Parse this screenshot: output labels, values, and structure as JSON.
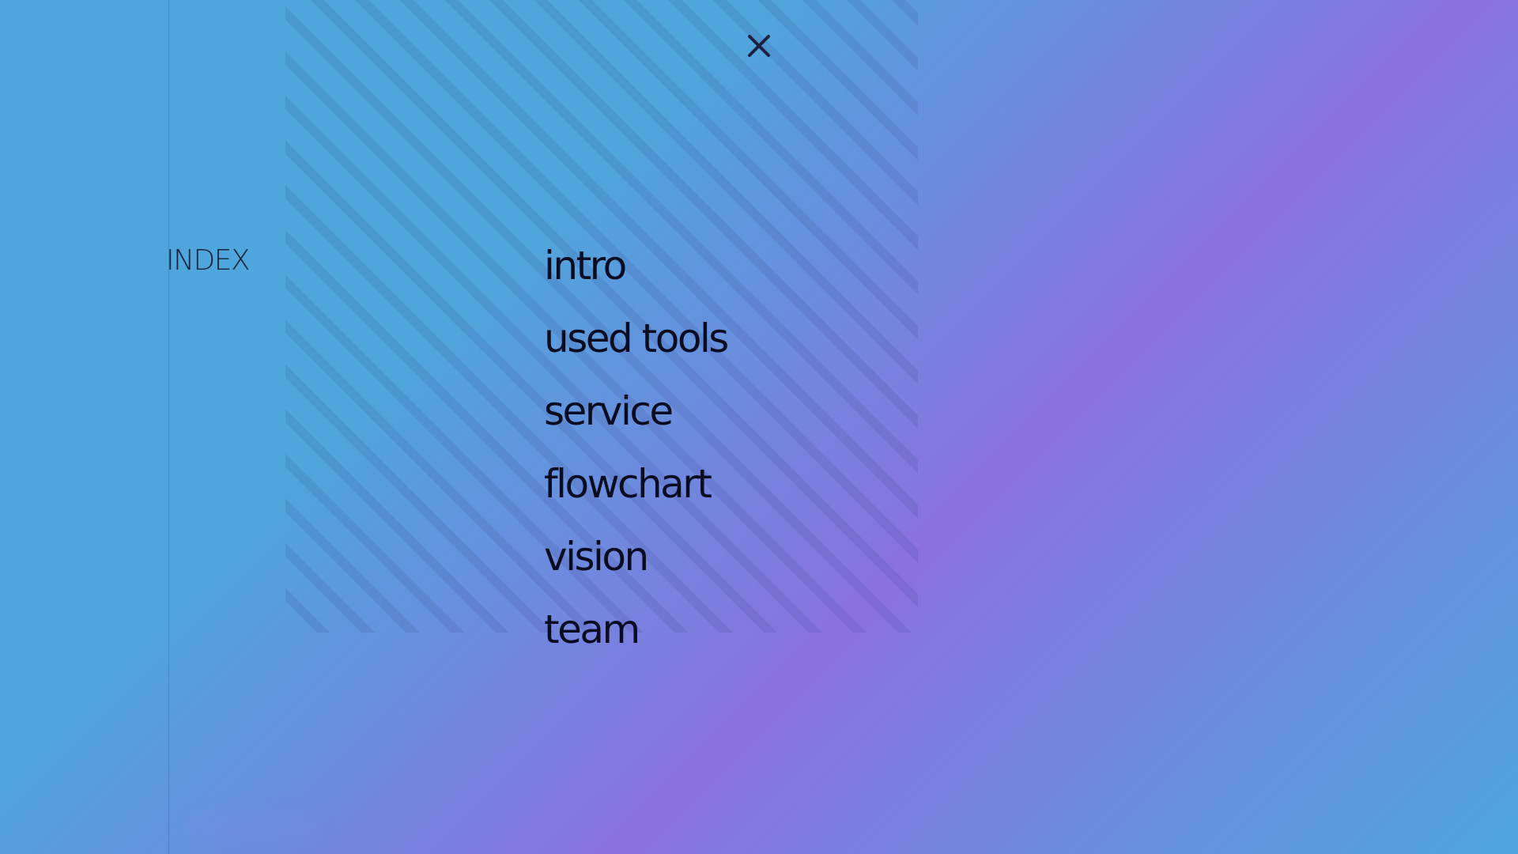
{
  "index_label": "INDEX",
  "close_icon": "close-icon",
  "menu": {
    "items": [
      {
        "label": "intro"
      },
      {
        "label": "used tools"
      },
      {
        "label": "service"
      },
      {
        "label": "flowchart"
      },
      {
        "label": "vision"
      },
      {
        "label": "team"
      }
    ]
  },
  "colors": {
    "gradient_blue": "#4ea6dc",
    "gradient_purple": "#8a71e0",
    "text": "#0a0d22"
  }
}
